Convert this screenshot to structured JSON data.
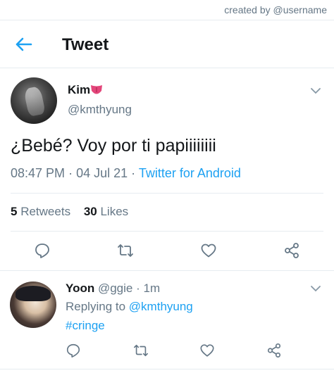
{
  "credit": "created by @username",
  "header": {
    "title": "Tweet"
  },
  "tweet": {
    "author_name": "Kim",
    "author_handle": "@kmthyung",
    "text": "¿Bebé? Voy por ti papiiiiiiii",
    "time": "08:47 PM",
    "date": "04 Jul 21",
    "source": "Twitter for Android",
    "retweets_count": "5",
    "retweets_label": "Retweets",
    "likes_count": "30",
    "likes_label": "Likes"
  },
  "reply": {
    "author_name": "Yoon",
    "author_handle": "@ggie",
    "age": "1m",
    "replying_label": "Replying to",
    "replying_to": "@kmthyung",
    "text": "#cringe"
  },
  "colors": {
    "accent": "#1da1f2",
    "secondary_text": "#657786",
    "divider": "#e6ecf0"
  },
  "icons": [
    "back-arrow-icon",
    "tongue-emoji-icon",
    "chevron-down-icon",
    "reply-icon",
    "retweet-icon",
    "like-icon",
    "share-icon"
  ]
}
